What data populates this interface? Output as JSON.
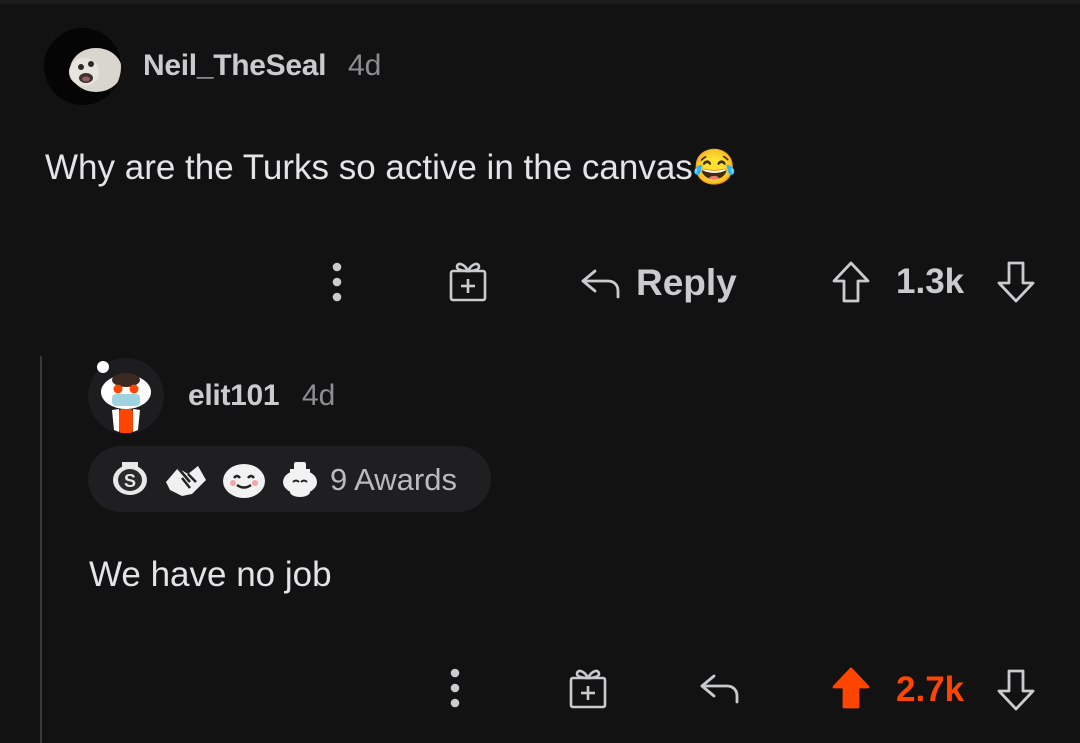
{
  "comment": {
    "username": "Neil_TheSeal",
    "age": "4d",
    "text": "Why are the Turks so active in the canvas😂",
    "reply_label": "Reply",
    "score": "1.3k"
  },
  "reply": {
    "username": "elit101",
    "age": "4d",
    "awards_label": "9 Awards",
    "text": "We have no job",
    "score": "2.7k",
    "upvoted": true
  },
  "colors": {
    "background": "#121212",
    "upvote_active": "#ff4500",
    "text_primary": "#d7dadc",
    "text_secondary": "#8c8e90"
  },
  "icons": [
    "more-icon",
    "gift-icon",
    "reply-icon",
    "upvote-icon",
    "downvote-icon",
    "seal-avatar-icon",
    "snoo-avatar-icon"
  ]
}
